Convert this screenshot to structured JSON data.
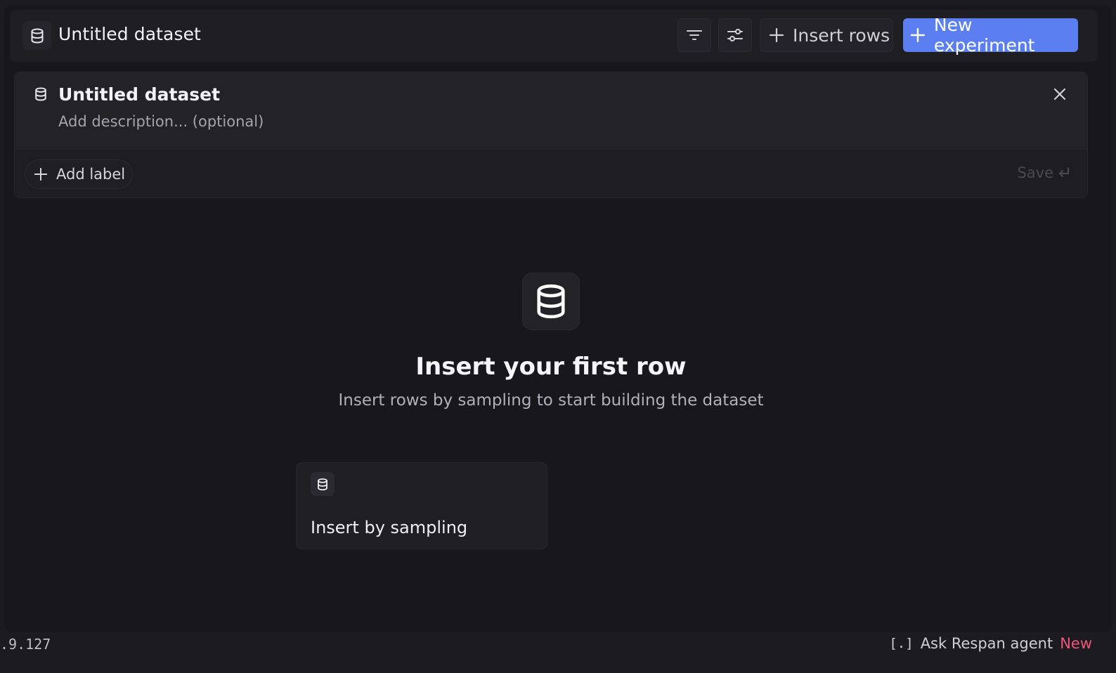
{
  "header": {
    "title": "Untitled dataset",
    "insert_rows_label": "Insert rows",
    "new_experiment_label": "New experiment"
  },
  "panel": {
    "title": "Untitled dataset",
    "description_placeholder": "Add description... (optional)",
    "add_label": "Add label",
    "save_label": "Save"
  },
  "empty_state": {
    "title": "Insert your first row",
    "subtitle": "Insert rows by sampling to start building the dataset",
    "option_label": "Insert by sampling"
  },
  "footer": {
    "version": ".9.127",
    "agent_shortcut": "[.]",
    "agent_label": "Ask Respan agent",
    "agent_badge": "New"
  },
  "colors": {
    "accent": "#5b7ff0",
    "badge": "#f2557a"
  },
  "icons": {
    "database": "database-icon",
    "filter": "filter-icon",
    "settings": "sliders-icon",
    "plus": "plus-icon",
    "close": "close-icon",
    "enter": "enter-icon"
  }
}
